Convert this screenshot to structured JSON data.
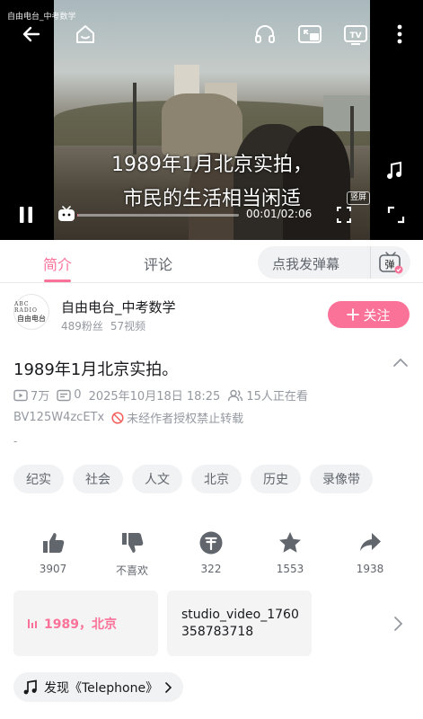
{
  "player": {
    "watermark": "自由电台_中考数学",
    "subtitle_line1": "1989年1月北京实拍，",
    "subtitle_line2": "市民的生活相当闲适",
    "vertical_tag": "竖屏",
    "time_readout": "00:01/02:06",
    "progress": 0.008,
    "icons": [
      "back-arrow-icon",
      "home-icon",
      "headphones-icon",
      "pip-icon",
      "tv-cast-icon",
      "more-vert-icon",
      "music-note-icon",
      "pause-icon",
      "danmaku-tv-icon",
      "vertical-mode-icon",
      "fullscreen-icon"
    ]
  },
  "tabs": {
    "intro": "简介",
    "comments": "评论",
    "danmaku_placeholder": "点我发弹幕",
    "danmaku_button": "弹"
  },
  "uploader": {
    "name": "自由电台_中考数学",
    "fans": "489粉丝",
    "videos": "57视频",
    "follow_label": "关注",
    "avatar_line1": "ABC RADIO",
    "avatar_line2": "自由电台"
  },
  "video": {
    "title": "1989年1月北京实拍。",
    "views": "7万",
    "danmaku_count": "0",
    "date": "2025年10月18日 18:25",
    "watching": "15人正在看",
    "bvid": "BV125W4zcETx",
    "copyright": "未经作者授权禁止转载",
    "description": "-"
  },
  "tags": [
    "纪实",
    "社会",
    "人文",
    "北京",
    "历史",
    "录像带"
  ],
  "actions": {
    "like": "3907",
    "dislike": "不喜欢",
    "coin": "322",
    "favorite": "1553",
    "share": "1938"
  },
  "cards": {
    "card_a": "1989，北京",
    "card_b_line1": "studio_video_1760",
    "card_b_line2": "358783718"
  },
  "music": {
    "label": "发现《Telephone》"
  },
  "colors": {
    "accent": "#fb7299",
    "text_secondary": "#9499a0",
    "chip_bg": "#f1f2f3",
    "copyright_red": "#f25d59"
  }
}
